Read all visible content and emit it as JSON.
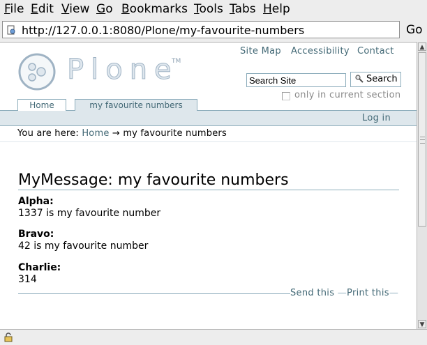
{
  "browser": {
    "menu": [
      {
        "label": "File"
      },
      {
        "label": "Edit"
      },
      {
        "label": "View"
      },
      {
        "label": "Go"
      },
      {
        "label": "Bookmarks"
      },
      {
        "label": "Tools"
      },
      {
        "label": "Tabs"
      },
      {
        "label": "Help"
      }
    ],
    "url": "http://127.0.0.1:8080/Plone/my-favourite-numbers",
    "go_label": "Go"
  },
  "site": {
    "logo_text": "Plone",
    "logo_tm": "TM",
    "site_actions": [
      "Site Map",
      "Accessibility",
      "Contact"
    ],
    "search_placeholder": "Search Site",
    "search_button": "Search",
    "search_scope_label": "only in current section",
    "tabs": [
      {
        "label": "Home",
        "selected": false
      },
      {
        "label": "my favourite numbers",
        "selected": true
      }
    ],
    "login_label": "Log in",
    "breadcrumbs": {
      "prefix": "You are here:",
      "home": "Home",
      "separator": "→",
      "current": "my favourite numbers"
    }
  },
  "content": {
    "title": "MyMessage: my favourite numbers",
    "fields": [
      {
        "label": "Alpha:",
        "value": "1337 is my favourite number"
      },
      {
        "label": "Bravo:",
        "value": "42 is my favourite number"
      },
      {
        "label": "Charlie:",
        "value": "314"
      }
    ],
    "document_actions": {
      "send": "Send this",
      "print": "Print this",
      "dash": "—"
    }
  },
  "colors": {
    "link": "#436976",
    "border": "#8cacbb",
    "tab_bg": "#dee7ec"
  }
}
